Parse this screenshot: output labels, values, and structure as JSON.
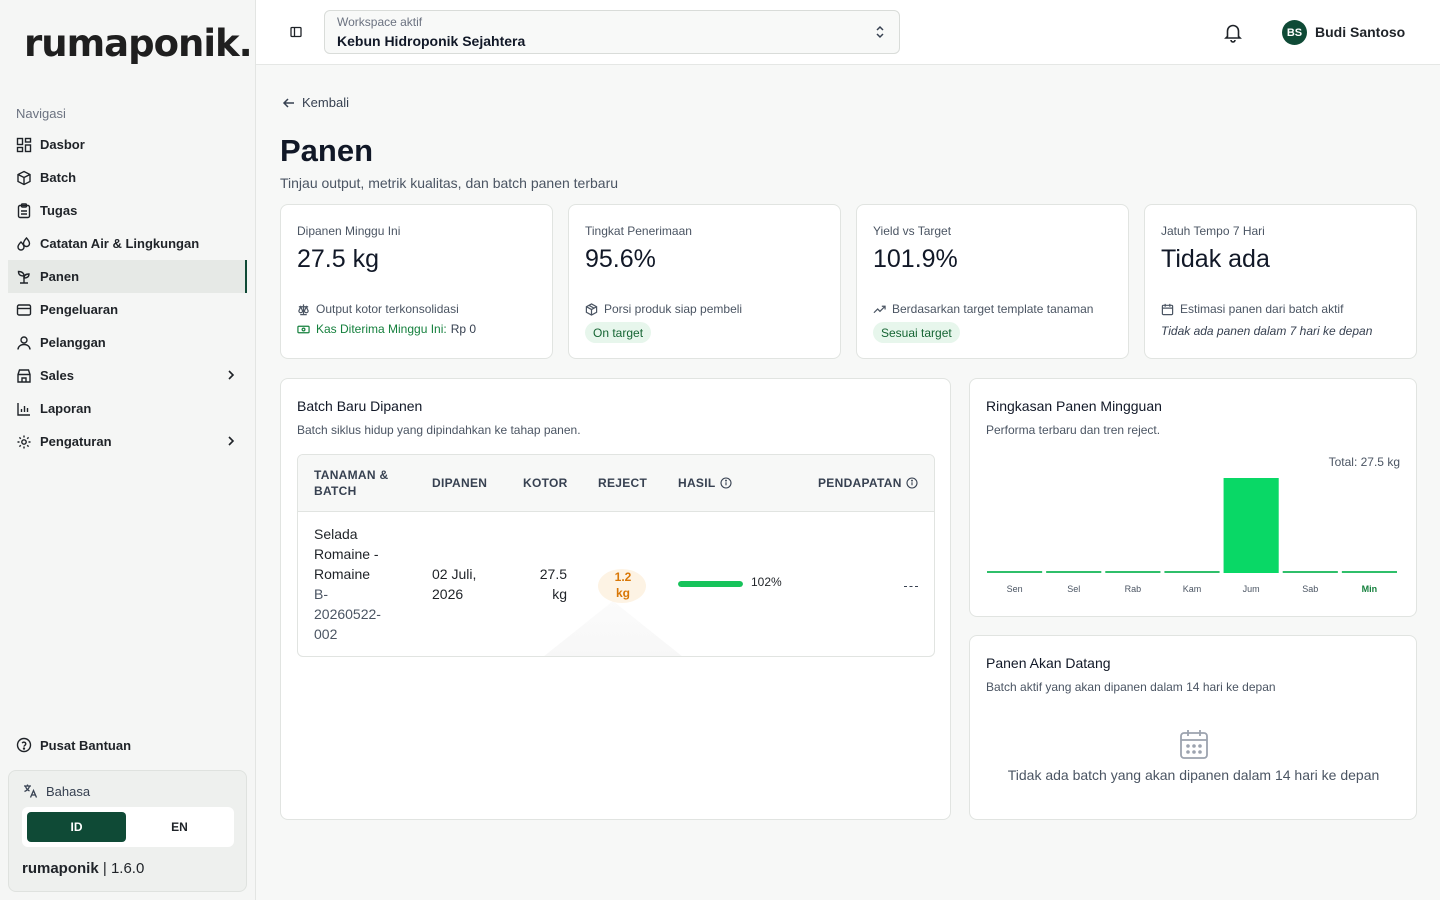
{
  "sidebar": {
    "logo": "rumaponik.",
    "nav_heading": "Navigasi",
    "items": [
      {
        "label": "Dasbor",
        "icon": "dashboard-icon"
      },
      {
        "label": "Batch",
        "icon": "box-icon"
      },
      {
        "label": "Tugas",
        "icon": "clipboard-icon"
      },
      {
        "label": "Catatan Air & Lingkungan",
        "icon": "droplets-icon"
      },
      {
        "label": "Panen",
        "icon": "sprout-icon",
        "active": true
      },
      {
        "label": "Pengeluaran",
        "icon": "wallet-icon"
      },
      {
        "label": "Pelanggan",
        "icon": "user-icon"
      },
      {
        "label": "Sales",
        "icon": "store-icon",
        "has_children": true
      },
      {
        "label": "Laporan",
        "icon": "bar-chart-icon"
      },
      {
        "label": "Pengaturan",
        "icon": "gear-icon",
        "has_children": true
      }
    ],
    "help": "Pusat Bantuan",
    "language": {
      "label": "Bahasa",
      "options": [
        "ID",
        "EN"
      ],
      "selected": "ID"
    },
    "version_brand": "rumaponik",
    "version_sep": "|",
    "version": "1.6.0"
  },
  "topbar": {
    "workspace_label": "Workspace aktif",
    "workspace_value": "Kebun Hidroponik Sejahtera",
    "avatar_initials": "BS",
    "user_name": "Budi Santoso"
  },
  "page": {
    "back": "Kembali",
    "title": "Panen",
    "subtitle": "Tinjau output, metrik kualitas, dan batch panen terbaru"
  },
  "stats": {
    "harvested": {
      "label": "Dipanen Minggu Ini",
      "value": "27.5 kg",
      "note": "Output kotor terkonsolidasi",
      "link_label": "Kas Diterima Minggu Ini:",
      "link_amount": "Rp 0"
    },
    "acceptance": {
      "label": "Tingkat Penerimaan",
      "value": "95.6%",
      "note": "Porsi produk siap pembeli",
      "pill": "On target"
    },
    "yield": {
      "label": "Yield vs Target",
      "value": "101.9%",
      "note": "Berdasarkan target template tanaman",
      "pill": "Sesuai target"
    },
    "due": {
      "label": "Jatuh Tempo 7 Hari",
      "value": "Tidak ada",
      "note": "Estimasi panen dari batch aktif",
      "italic": "Tidak ada panen dalam 7 hari ke depan"
    }
  },
  "batches": {
    "title": "Batch Baru Dipanen",
    "subtitle": "Batch siklus hidup yang dipindahkan ke tahap panen.",
    "columns": {
      "crop_line1": "TANAMAN &",
      "crop_line2": "BATCH",
      "harvested": "DIPANEN",
      "gross": "KOTOR",
      "reject": "REJECT",
      "yield": "HASIL",
      "revenue": "PENDAPATAN"
    },
    "rows": [
      {
        "crop": [
          "Selada",
          "Romaine -",
          "Romaine"
        ],
        "batch": [
          "B-",
          "20260522-",
          "002"
        ],
        "date": [
          "02 Juli,",
          "2026"
        ],
        "gross": [
          "27.5",
          "kg"
        ],
        "reject": [
          "1.2",
          "kg"
        ],
        "yield_pct": 102,
        "yield_label": "102%"
      }
    ]
  },
  "weekly": {
    "title": "Ringkasan Panen Mingguan",
    "subtitle": "Performa terbaru dan tren reject.",
    "total": "Total: 27.5 kg"
  },
  "chart_data": {
    "type": "bar",
    "categories": [
      "Sen",
      "Sel",
      "Rab",
      "Kam",
      "Jum",
      "Sab",
      "Min"
    ],
    "values": [
      0,
      0,
      0,
      0,
      27.5,
      0,
      0
    ],
    "highlight": "Min",
    "colors": {
      "bar": "#09d866",
      "zero": "#2fbf6a",
      "today_label": "#15803d"
    }
  },
  "upcoming": {
    "title": "Panen Akan Datang",
    "subtitle": "Batch aktif yang akan dipanen dalam 14 hari ke depan",
    "empty": "Tidak ada batch yang akan dipanen dalam 14 hari ke depan"
  }
}
